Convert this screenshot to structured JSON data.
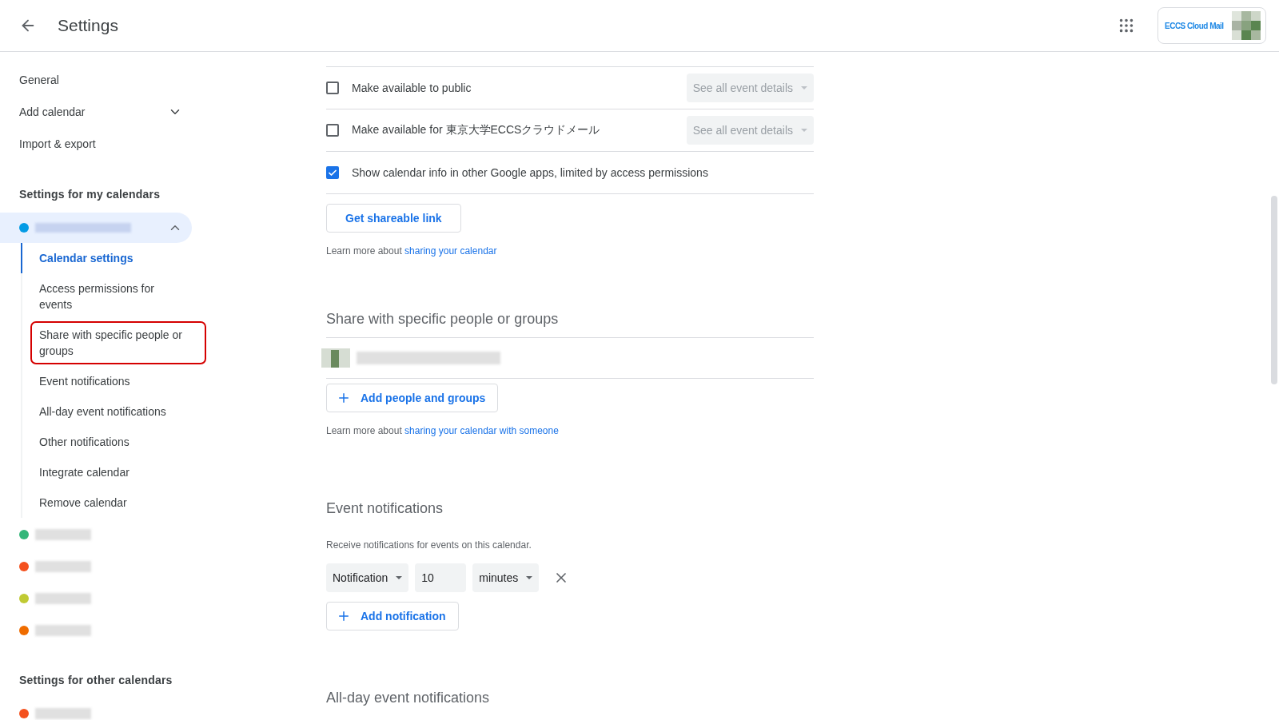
{
  "header": {
    "title": "Settings",
    "logo_text": "ECCS Cloud Mail"
  },
  "sidebar": {
    "items": [
      {
        "label": "General",
        "kind": "link"
      },
      {
        "label": "Add calendar",
        "kind": "expander",
        "expanded": false
      },
      {
        "label": "Import & export",
        "kind": "link"
      }
    ],
    "my_calendars": {
      "heading": "Settings for my calendars",
      "calendars": [
        {
          "color": "#039be5",
          "selected": true,
          "expanded": true,
          "children": [
            {
              "label": "Calendar settings",
              "selected": true,
              "highlighted": false
            },
            {
              "label": "Access permissions for events",
              "selected": false,
              "highlighted": false
            },
            {
              "label": "Share with specific people or groups",
              "selected": false,
              "highlighted": true
            },
            {
              "label": "Event notifications",
              "selected": false,
              "highlighted": false
            },
            {
              "label": "All-day event notifications",
              "selected": false,
              "highlighted": false
            },
            {
              "label": "Other notifications",
              "selected": false,
              "highlighted": false
            },
            {
              "label": "Integrate calendar",
              "selected": false,
              "highlighted": false
            },
            {
              "label": "Remove calendar",
              "selected": false,
              "highlighted": false
            }
          ]
        },
        {
          "color": "#33b679",
          "selected": false,
          "expanded": false
        },
        {
          "color": "#f4511e",
          "selected": false,
          "expanded": false
        },
        {
          "color": "#c0ca33",
          "selected": false,
          "expanded": false
        },
        {
          "color": "#ef6c00",
          "selected": false,
          "expanded": false
        }
      ]
    },
    "other_calendars": {
      "heading": "Settings for other calendars",
      "calendars": [
        {
          "color": "#f4511e",
          "selected": false,
          "expanded": false
        }
      ]
    }
  },
  "access_permissions": {
    "options": [
      {
        "label": "Make available to public",
        "checked": false,
        "dropdown": {
          "value": "See all event details",
          "disabled": true
        }
      },
      {
        "label": "Make available for 東京大学ECCSクラウドメール",
        "checked": false,
        "dropdown": {
          "value": "See all event details",
          "disabled": true
        }
      },
      {
        "label": "Show calendar info in other Google apps, limited by access permissions",
        "checked": true
      }
    ],
    "button": "Get shareable link",
    "learn_more": {
      "text": "Learn more about",
      "link": "sharing your calendar"
    }
  },
  "share": {
    "heading": "Share with specific people or groups",
    "people": [
      {
        "kind": "redacted"
      }
    ],
    "button": "Add people and groups",
    "learn_more": {
      "text": "Learn more about",
      "link": "sharing your calendar with someone"
    }
  },
  "event_notifications": {
    "heading": "Event notifications",
    "description": "Receive notifications for events on this calendar.",
    "notifications": [
      {
        "type": "Notification",
        "amount": "10",
        "unit": "minutes"
      }
    ],
    "button": "Add notification"
  },
  "all_day_notifications": {
    "heading": "All-day event notifications"
  }
}
